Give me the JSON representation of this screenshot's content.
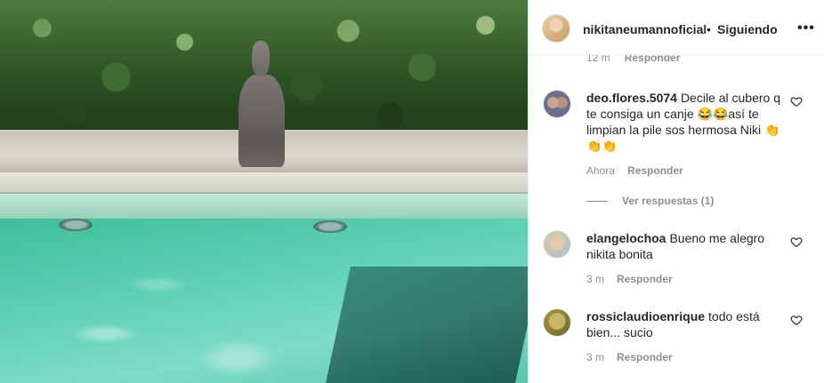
{
  "post": {
    "image_description_icon": "photo"
  },
  "header": {
    "username": "nikitaneumannoficial",
    "separator": "•",
    "follow_state": "Siguiendo",
    "more_icon": "ellipsis-icon",
    "more_label": "•••"
  },
  "partial_meta": {
    "time": "12 m",
    "reply": "Responder"
  },
  "comments": [
    {
      "username": "deo.flores.5074",
      "text": "Decile al cubero q te consiga un canje 😂😂así te limpian la pile sos hermosa Niki 👏👏👏",
      "time": "Ahora",
      "reply": "Responder",
      "avatar_color": "#6b6f8a"
    },
    {
      "username": "elangelochoa",
      "text": "Bueno me alegro nikita bonita",
      "time": "3 m",
      "reply": "Responder",
      "avatar_color": "#c9b79a"
    },
    {
      "username": "rossiclaudioenrique",
      "text": "todo está bien... sucio",
      "time": "3 m",
      "reply": "Responder",
      "avatar_color": "#8a7a3a"
    }
  ],
  "view_replies": "Ver respuestas (1)",
  "colors": {
    "text": "#262626",
    "muted": "#8e8e8e",
    "border": "#efefef"
  }
}
